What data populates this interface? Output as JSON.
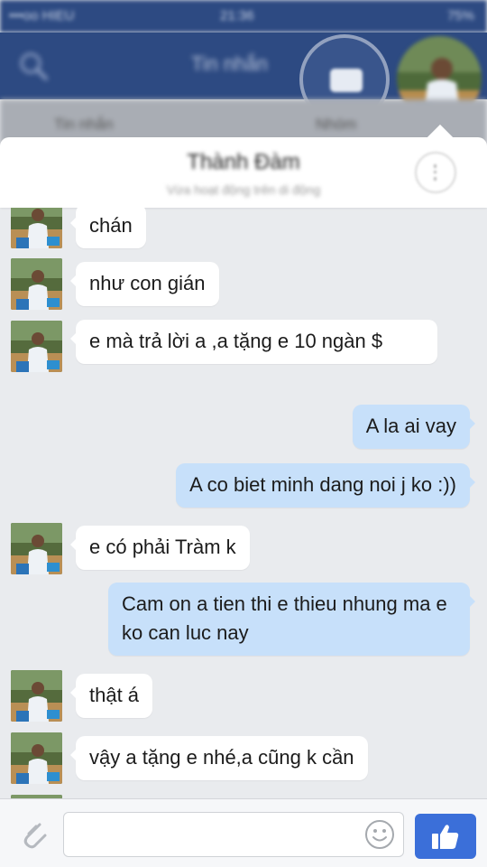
{
  "status_bar": {
    "carrier": "•••oo HIEU",
    "time": "21:36",
    "battery": "75%"
  },
  "header": {
    "title": "Tin nhắn",
    "tabs": [
      "Tin nhắn",
      "Nhóm"
    ]
  },
  "conversation": {
    "name": "Thành Đàm",
    "subtitle": "Vừa hoạt động trên di động"
  },
  "messages": [
    {
      "from": "them",
      "text": "chán"
    },
    {
      "from": "them",
      "text": "như con gián"
    },
    {
      "from": "them",
      "text": "e mà trả lời a ,a tặng e 10 ngàn $"
    },
    {
      "from": "me",
      "text": "A la ai vay"
    },
    {
      "from": "me",
      "text": "A co biet minh dang noi j ko :))"
    },
    {
      "from": "them",
      "text": "e có phải Tràm k"
    },
    {
      "from": "me",
      "text": "Cam on a tien thi e thieu nhung ma e ko can luc nay"
    },
    {
      "from": "them",
      "text": "thật á"
    },
    {
      "from": "them",
      "text": "vậy a tặng e nhé,a cũng k cần"
    }
  ],
  "composer": {
    "placeholder": ""
  },
  "colors": {
    "header_bg": "#2d4a82",
    "outgoing_bubble": "#c7e0fa",
    "incoming_bubble": "#ffffff",
    "like_button": "#3b6fd9"
  },
  "icons": [
    "search-icon",
    "compose-icon",
    "more-icon",
    "attach-icon",
    "smiley-icon",
    "thumbs-up-icon"
  ]
}
